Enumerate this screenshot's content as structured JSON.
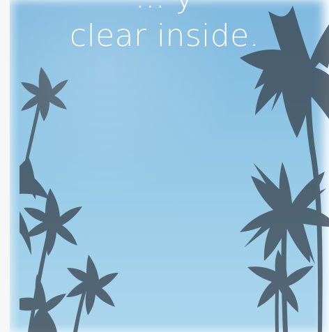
{
  "caption": {
    "line_1": "... y",
    "line_2": "clear inside."
  },
  "colors": {
    "sky_top": "#78b5dd",
    "sky_bottom": "#a4d3eb",
    "text": "#ffffff",
    "palm": "#31404d"
  },
  "icons": [
    "palm-tree-icon"
  ]
}
